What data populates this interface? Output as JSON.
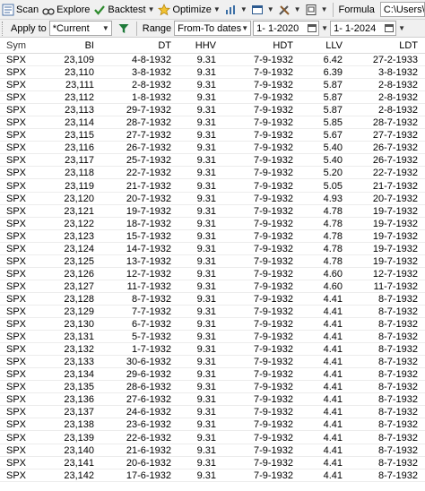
{
  "toolbar": {
    "scan_label": "Scan",
    "explore_label": "Explore",
    "backtest_label": "Backtest",
    "optimize_label": "Optimize",
    "formula_label": "Formula",
    "formula_path": "C:\\Users\\hansv\\OneDrive\\Systems"
  },
  "filter": {
    "apply_to_label": "Apply to",
    "apply_to_value": "*Current",
    "range_label": "Range",
    "range_value": "From-To dates",
    "from_date": "1- 1-2020",
    "to_date": "1- 1-2024"
  },
  "table": {
    "columns": [
      "Sym",
      "BI",
      "DT",
      "HHV",
      "HDT",
      "LLV",
      "LDT"
    ],
    "rows": [
      [
        "SPX",
        "23,109",
        "4-8-1932",
        "9.31",
        "7-9-1932",
        "6.42",
        "27-2-1933"
      ],
      [
        "SPX",
        "23,110",
        "3-8-1932",
        "9.31",
        "7-9-1932",
        "6.39",
        "3-8-1932"
      ],
      [
        "SPX",
        "23,111",
        "2-8-1932",
        "9.31",
        "7-9-1932",
        "5.87",
        "2-8-1932"
      ],
      [
        "SPX",
        "23,112",
        "1-8-1932",
        "9.31",
        "7-9-1932",
        "5.87",
        "2-8-1932"
      ],
      [
        "SPX",
        "23,113",
        "29-7-1932",
        "9.31",
        "7-9-1932",
        "5.87",
        "2-8-1932"
      ],
      [
        "SPX",
        "23,114",
        "28-7-1932",
        "9.31",
        "7-9-1932",
        "5.85",
        "28-7-1932"
      ],
      [
        "SPX",
        "23,115",
        "27-7-1932",
        "9.31",
        "7-9-1932",
        "5.67",
        "27-7-1932"
      ],
      [
        "SPX",
        "23,116",
        "26-7-1932",
        "9.31",
        "7-9-1932",
        "5.40",
        "26-7-1932"
      ],
      [
        "SPX",
        "23,117",
        "25-7-1932",
        "9.31",
        "7-9-1932",
        "5.40",
        "26-7-1932"
      ],
      [
        "SPX",
        "23,118",
        "22-7-1932",
        "9.31",
        "7-9-1932",
        "5.20",
        "22-7-1932"
      ],
      [
        "SPX",
        "23,119",
        "21-7-1932",
        "9.31",
        "7-9-1932",
        "5.05",
        "21-7-1932"
      ],
      [
        "SPX",
        "23,120",
        "20-7-1932",
        "9.31",
        "7-9-1932",
        "4.93",
        "20-7-1932"
      ],
      [
        "SPX",
        "23,121",
        "19-7-1932",
        "9.31",
        "7-9-1932",
        "4.78",
        "19-7-1932"
      ],
      [
        "SPX",
        "23,122",
        "18-7-1932",
        "9.31",
        "7-9-1932",
        "4.78",
        "19-7-1932"
      ],
      [
        "SPX",
        "23,123",
        "15-7-1932",
        "9.31",
        "7-9-1932",
        "4.78",
        "19-7-1932"
      ],
      [
        "SPX",
        "23,124",
        "14-7-1932",
        "9.31",
        "7-9-1932",
        "4.78",
        "19-7-1932"
      ],
      [
        "SPX",
        "23,125",
        "13-7-1932",
        "9.31",
        "7-9-1932",
        "4.78",
        "19-7-1932"
      ],
      [
        "SPX",
        "23,126",
        "12-7-1932",
        "9.31",
        "7-9-1932",
        "4.60",
        "12-7-1932"
      ],
      [
        "SPX",
        "23,127",
        "11-7-1932",
        "9.31",
        "7-9-1932",
        "4.60",
        "11-7-1932"
      ],
      [
        "SPX",
        "23,128",
        "8-7-1932",
        "9.31",
        "7-9-1932",
        "4.41",
        "8-7-1932"
      ],
      [
        "SPX",
        "23,129",
        "7-7-1932",
        "9.31",
        "7-9-1932",
        "4.41",
        "8-7-1932"
      ],
      [
        "SPX",
        "23,130",
        "6-7-1932",
        "9.31",
        "7-9-1932",
        "4.41",
        "8-7-1932"
      ],
      [
        "SPX",
        "23,131",
        "5-7-1932",
        "9.31",
        "7-9-1932",
        "4.41",
        "8-7-1932"
      ],
      [
        "SPX",
        "23,132",
        "1-7-1932",
        "9.31",
        "7-9-1932",
        "4.41",
        "8-7-1932"
      ],
      [
        "SPX",
        "23,133",
        "30-6-1932",
        "9.31",
        "7-9-1932",
        "4.41",
        "8-7-1932"
      ],
      [
        "SPX",
        "23,134",
        "29-6-1932",
        "9.31",
        "7-9-1932",
        "4.41",
        "8-7-1932"
      ],
      [
        "SPX",
        "23,135",
        "28-6-1932",
        "9.31",
        "7-9-1932",
        "4.41",
        "8-7-1932"
      ],
      [
        "SPX",
        "23,136",
        "27-6-1932",
        "9.31",
        "7-9-1932",
        "4.41",
        "8-7-1932"
      ],
      [
        "SPX",
        "23,137",
        "24-6-1932",
        "9.31",
        "7-9-1932",
        "4.41",
        "8-7-1932"
      ],
      [
        "SPX",
        "23,138",
        "23-6-1932",
        "9.31",
        "7-9-1932",
        "4.41",
        "8-7-1932"
      ],
      [
        "SPX",
        "23,139",
        "22-6-1932",
        "9.31",
        "7-9-1932",
        "4.41",
        "8-7-1932"
      ],
      [
        "SPX",
        "23,140",
        "21-6-1932",
        "9.31",
        "7-9-1932",
        "4.41",
        "8-7-1932"
      ],
      [
        "SPX",
        "23,141",
        "20-6-1932",
        "9.31",
        "7-9-1932",
        "4.41",
        "8-7-1932"
      ],
      [
        "SPX",
        "23,142",
        "17-6-1932",
        "9.31",
        "7-9-1932",
        "4.41",
        "8-7-1932"
      ]
    ]
  },
  "icons": {
    "scan": "scan-icon",
    "explore": "explore-icon",
    "backtest": "checkmark-icon",
    "optimize": "star-icon",
    "chart": "chart-icon",
    "window": "window-icon",
    "tools": "tools-icon",
    "report": "report-icon",
    "filter": "filter-icon"
  },
  "colors": {
    "backtest_check": "#2e8b2e",
    "optimize_star": "#d4a017",
    "filter_funnel": "#1f7a3a",
    "toolbar_bg": "#f0f0f0"
  }
}
